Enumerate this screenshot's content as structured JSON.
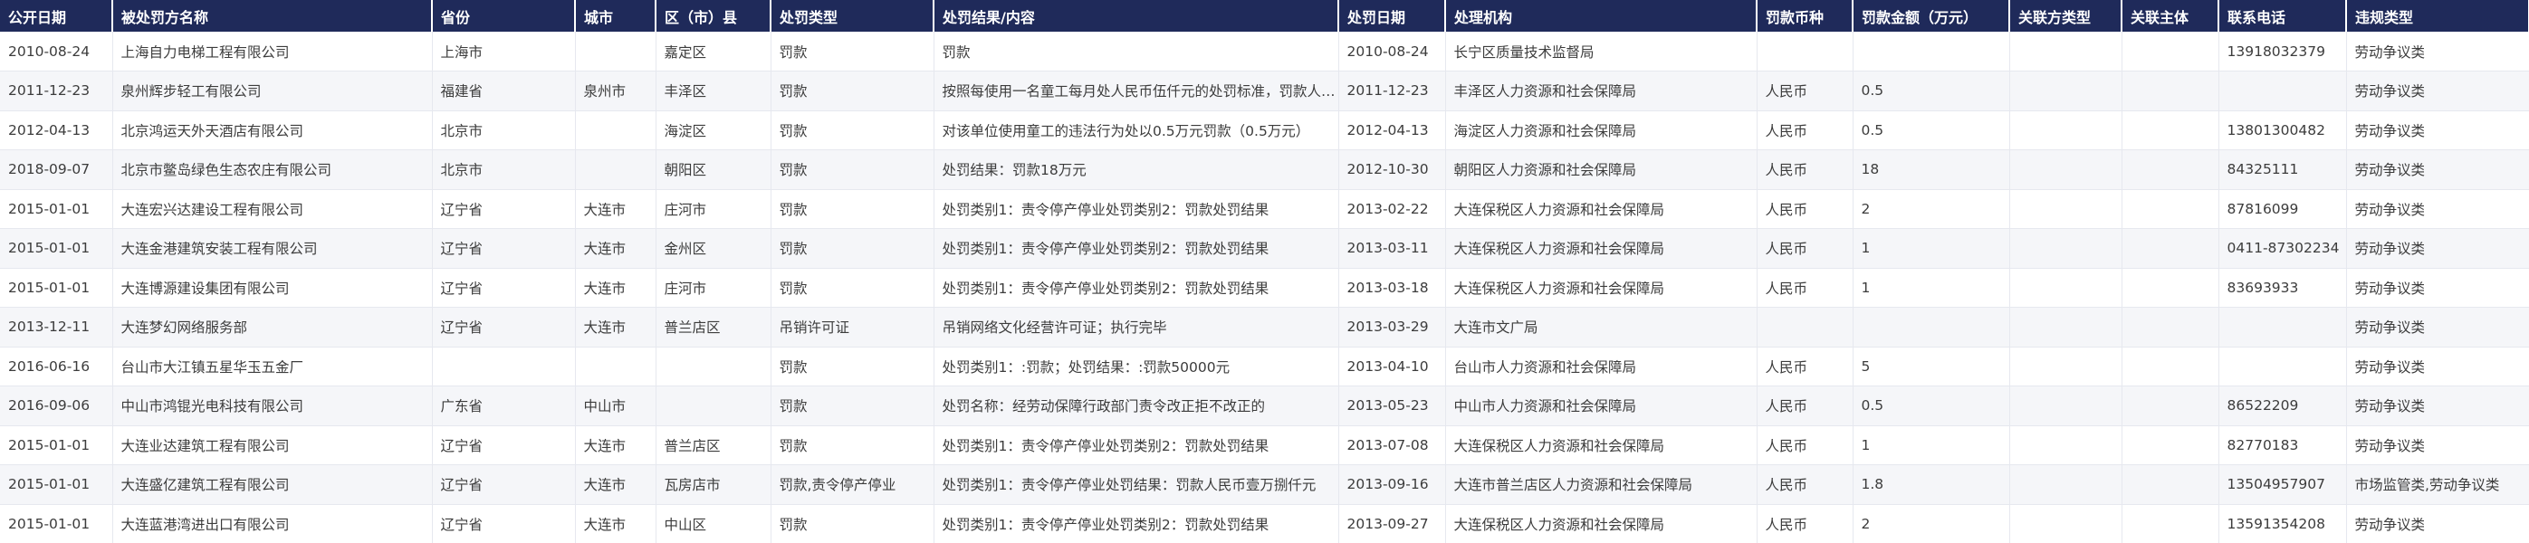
{
  "columns": [
    "公开日期",
    "被处罚方名称",
    "省份",
    "城市",
    "区（市）县",
    "处罚类型",
    "处罚结果/内容",
    "处罚日期",
    "处理机构",
    "罚款币种",
    "罚款金额（万元）",
    "关联方类型",
    "关联主体",
    "联系电话",
    "违规类型"
  ],
  "rows": [
    [
      "2010-08-24",
      "上海自力电梯工程有限公司",
      "上海市",
      "",
      "嘉定区",
      "罚款",
      "罚款",
      "2010-08-24",
      "长宁区质量技术监督局",
      "",
      "",
      "",
      "",
      "13918032379",
      "劳动争议类"
    ],
    [
      "2011-12-23",
      "泉州辉步轻工有限公司",
      "福建省",
      "泉州市",
      "丰泽区",
      "罚款",
      "按照每使用一名童工每月处人民币伍仟元的处罚标准，罚款人民币伍仟元",
      "2011-12-23",
      "丰泽区人力资源和社会保障局",
      "人民币",
      "0.5",
      "",
      "",
      "",
      "劳动争议类"
    ],
    [
      "2012-04-13",
      "北京鸿运天外天酒店有限公司",
      "北京市",
      "",
      "海淀区",
      "罚款",
      "对该单位使用童工的违法行为处以0.5万元罚款（0.5万元）",
      "2012-04-13",
      "海淀区人力资源和社会保障局",
      "人民币",
      "0.5",
      "",
      "",
      "13801300482",
      "劳动争议类"
    ],
    [
      "2018-09-07",
      "北京市鳖岛绿色生态农庄有限公司",
      "北京市",
      "",
      "朝阳区",
      "罚款",
      "处罚结果：罚款18万元",
      "2012-10-30",
      "朝阳区人力资源和社会保障局",
      "人民币",
      "18",
      "",
      "",
      "84325111",
      "劳动争议类"
    ],
    [
      "2015-01-01",
      "大连宏兴达建设工程有限公司",
      "辽宁省",
      "大连市",
      "庄河市",
      "罚款",
      "处罚类别1：责令停产停业处罚类别2：罚款处罚结果",
      "2013-02-22",
      "大连保税区人力资源和社会保障局",
      "人民币",
      "2",
      "",
      "",
      "87816099",
      "劳动争议类"
    ],
    [
      "2015-01-01",
      "大连金港建筑安装工程有限公司",
      "辽宁省",
      "大连市",
      "金州区",
      "罚款",
      "处罚类别1：责令停产停业处罚类别2：罚款处罚结果",
      "2013-03-11",
      "大连保税区人力资源和社会保障局",
      "人民币",
      "1",
      "",
      "",
      "0411-87302234",
      "劳动争议类"
    ],
    [
      "2015-01-01",
      "大连博源建设集团有限公司",
      "辽宁省",
      "大连市",
      "庄河市",
      "罚款",
      "处罚类别1：责令停产停业处罚类别2：罚款处罚结果",
      "2013-03-18",
      "大连保税区人力资源和社会保障局",
      "人民币",
      "1",
      "",
      "",
      "83693933",
      "劳动争议类"
    ],
    [
      "2013-12-11",
      "大连梦幻网络服务部",
      "辽宁省",
      "大连市",
      "普兰店区",
      "吊销许可证",
      "吊销网络文化经营许可证；执行完毕",
      "2013-03-29",
      "大连市文广局",
      "",
      "",
      "",
      "",
      "",
      "劳动争议类"
    ],
    [
      "2016-06-16",
      "台山市大江镇五星华玉五金厂",
      "",
      "",
      "",
      "罚款",
      "处罚类别1：:罚款；处罚结果：:罚款50000元",
      "2013-04-10",
      "台山市人力资源和社会保障局",
      "人民币",
      "5",
      "",
      "",
      "",
      "劳动争议类"
    ],
    [
      "2016-09-06",
      "中山市鸿锟光电科技有限公司",
      "广东省",
      "中山市",
      "",
      "罚款",
      "处罚名称：经劳动保障行政部门责令改正拒不改正的",
      "2013-05-23",
      "中山市人力资源和社会保障局",
      "人民币",
      "0.5",
      "",
      "",
      "86522209",
      "劳动争议类"
    ],
    [
      "2015-01-01",
      "大连业达建筑工程有限公司",
      "辽宁省",
      "大连市",
      "普兰店区",
      "罚款",
      "处罚类别1：责令停产停业处罚类别2：罚款处罚结果",
      "2013-07-08",
      "大连保税区人力资源和社会保障局",
      "人民币",
      "1",
      "",
      "",
      "82770183",
      "劳动争议类"
    ],
    [
      "2015-01-01",
      "大连盛亿建筑工程有限公司",
      "辽宁省",
      "大连市",
      "瓦房店市",
      "罚款,责令停产停业",
      "处罚类别1：责令停产停业处罚结果：罚款人民币壹万捌仟元",
      "2013-09-16",
      "大连市普兰店区人力资源和社会保障局",
      "人民币",
      "1.8",
      "",
      "",
      "13504957907",
      "市场监管类,劳动争议类"
    ],
    [
      "2015-01-01",
      "大连蓝港湾进出口有限公司",
      "辽宁省",
      "大连市",
      "中山区",
      "罚款",
      "处罚类别1：责令停产停业处罚类别2：罚款处罚结果",
      "2013-09-27",
      "大连保税区人力资源和社会保障局",
      "人民币",
      "2",
      "",
      "",
      "13591354208",
      "劳动争议类"
    ]
  ]
}
